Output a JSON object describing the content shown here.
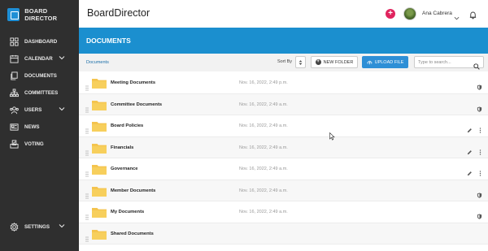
{
  "brand": {
    "name": "BOARD DIRECTOR"
  },
  "sidebar": {
    "items": [
      {
        "label": "DASHBOARD",
        "icon": "grid-icon",
        "chevron": false
      },
      {
        "label": "CALENDAR",
        "icon": "calendar-icon",
        "chevron": true
      },
      {
        "label": "DOCUMENTS",
        "icon": "documents-icon",
        "chevron": false
      },
      {
        "label": "COMMITTEES",
        "icon": "org-chart-icon",
        "chevron": false
      },
      {
        "label": "USERS",
        "icon": "users-icon",
        "chevron": true
      },
      {
        "label": "NEWS",
        "icon": "newspaper-icon",
        "chevron": false
      },
      {
        "label": "VOTING",
        "icon": "voting-icon",
        "chevron": false
      }
    ],
    "settings": {
      "label": "SETTINGS",
      "icon": "gear-icon"
    }
  },
  "header": {
    "app_title": "BoardDirector",
    "user_name": "Ana Cabrera"
  },
  "page": {
    "title": "DOCUMENTS"
  },
  "toolbar": {
    "breadcrumb": "Documents",
    "sort_label": "Sort By",
    "new_folder_label": "NEW FOLDER",
    "upload_label": "UPLOAD FILE",
    "search_placeholder": "Type to search..."
  },
  "documents": [
    {
      "name": "Meeting Documents",
      "date": "Nov. 16, 2022, 2:49 p.m.",
      "actions": [
        "shield"
      ]
    },
    {
      "name": "Committee Documents",
      "date": "Nov. 16, 2022, 2:49 a.m.",
      "actions": [
        "shield"
      ]
    },
    {
      "name": "Board Policies",
      "date": "Nov. 16, 2022, 2:49 a.m.",
      "actions": [
        "edit",
        "more"
      ]
    },
    {
      "name": "Financials",
      "date": "Nov. 16, 2022, 2:49 a.m.",
      "actions": [
        "edit",
        "more"
      ]
    },
    {
      "name": "Governance",
      "date": "Nov. 16, 2022, 2:49 a.m.",
      "actions": [
        "edit",
        "more"
      ]
    },
    {
      "name": "Member Documents",
      "date": "Nov. 16, 2022, 2:49 a.m.",
      "actions": [
        "shield"
      ]
    },
    {
      "name": "My Documents",
      "date": "Nov. 16, 2022, 2:49 a.m.",
      "actions": [
        "shield"
      ]
    },
    {
      "name": "Shared Documents",
      "date": "",
      "actions": []
    }
  ],
  "colors": {
    "sidebar_bg": "#2f2f2f",
    "header_blue": "#1b8fcf",
    "upload_blue": "#2e8fd6",
    "plus_red": "#e0245e",
    "folder_yellow": "#f7cf5c"
  }
}
